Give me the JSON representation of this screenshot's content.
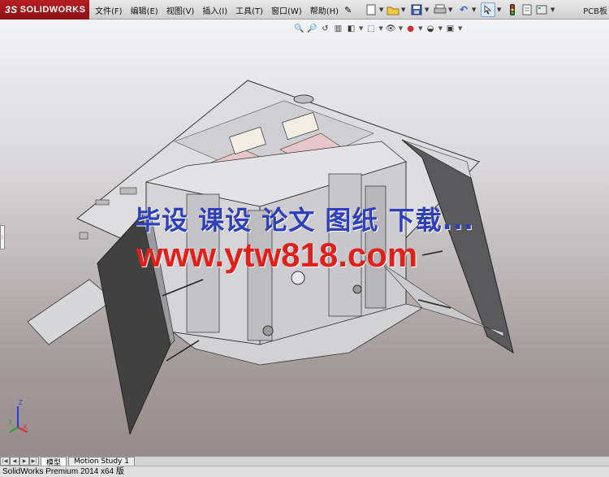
{
  "app": {
    "logo_prefix": "3S",
    "logo_text": "SOLIDWORKS"
  },
  "menu": {
    "items": [
      "文件(F)",
      "编辑(E)",
      "视图(V)",
      "插入(I)",
      "工具(T)",
      "窗口(W)",
      "帮助(H)"
    ]
  },
  "toolbar": {
    "icons": [
      "new-document-icon",
      "open-folder-icon",
      "save-icon",
      "print-icon",
      "undo-icon",
      "select-cursor-icon",
      "rebuild-icon",
      "file-properties-icon",
      "options-icon"
    ],
    "right_label": "PCB板"
  },
  "heads_up": {
    "icons": [
      "zoom-to-fit-icon",
      "zoom-area-icon",
      "previous-view-icon",
      "section-view-icon",
      "view-orientation-icon",
      "display-style-icon",
      "hide-show-icon",
      "appearance-icon",
      "scene-icon",
      "view-settings-icon"
    ]
  },
  "watermark": {
    "line1": "毕设 课设 论文 图纸 下载...",
    "line2": "www.ytw818.com"
  },
  "triad": {
    "axis_y": "Y",
    "axis_z": "Z",
    "axis_x": "X"
  },
  "tabs": {
    "model": "模型",
    "motion": "Motion Study 1"
  },
  "status": {
    "text": "SolidWorks Premium 2014 x64 版"
  },
  "colors": {
    "brand": "#b51e23",
    "watermark_blue": "#2e3fb8",
    "watermark_red": "#e0201a"
  }
}
